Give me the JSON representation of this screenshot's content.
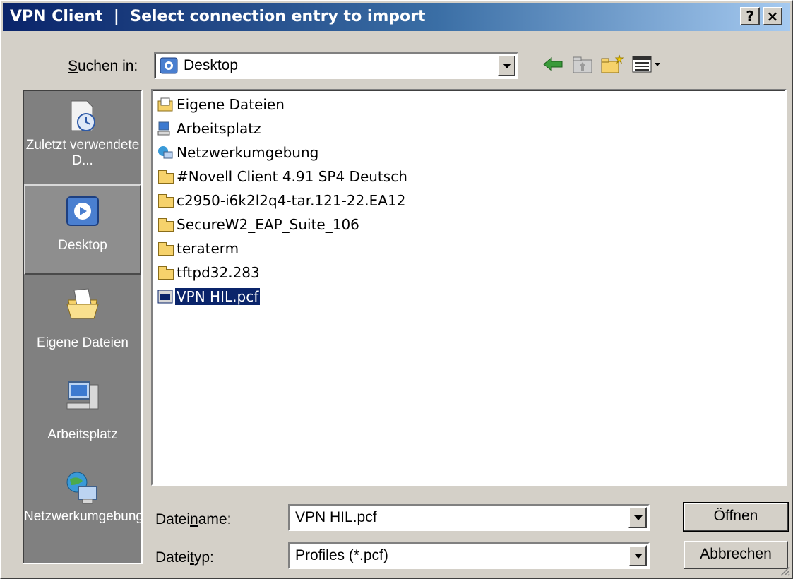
{
  "title": "VPN Client  |  Select connection entry to import",
  "title_buttons": {
    "help": "?",
    "close": "×"
  },
  "toolbar": {
    "look_in_label": "Suchen in:",
    "look_in_value": "Desktop",
    "icons": [
      "back-arrow-icon",
      "up-folder-icon",
      "new-folder-icon",
      "view-menu-icon"
    ]
  },
  "places": [
    {
      "label": "Zuletzt verwendete D...",
      "icon": "recent-documents-icon"
    },
    {
      "label": "Desktop",
      "icon": "desktop-icon",
      "selected": true
    },
    {
      "label": "Eigene Dateien",
      "icon": "my-documents-icon"
    },
    {
      "label": "Arbeitsplatz",
      "icon": "my-computer-icon"
    },
    {
      "label": "Netzwerkumgebung",
      "icon": "network-places-icon"
    }
  ],
  "files": [
    {
      "name": "Eigene Dateien",
      "icon": "my-documents-icon"
    },
    {
      "name": "Arbeitsplatz",
      "icon": "my-computer-icon"
    },
    {
      "name": "Netzwerkumgebung",
      "icon": "network-icon"
    },
    {
      "name": "#Novell Client 4.91 SP4 Deutsch",
      "icon": "folder-icon"
    },
    {
      "name": "c2950-i6k2l2q4-tar.121-22.EA12",
      "icon": "folder-icon"
    },
    {
      "name": "SecureW2_EAP_Suite_106",
      "icon": "folder-icon"
    },
    {
      "name": "teraterm",
      "icon": "folder-icon"
    },
    {
      "name": "tftpd32.283",
      "icon": "folder-icon"
    },
    {
      "name": "VPN HIL.pcf",
      "icon": "pcf-file-icon",
      "selected": true
    }
  ],
  "filename": {
    "label": "Dateiname:",
    "value": "VPN HIL.pcf"
  },
  "filetype": {
    "label": "Dateityp:",
    "value": "Profiles (*.pcf)"
  },
  "buttons": {
    "open": "Öffnen",
    "cancel": "Abbrechen"
  },
  "colors": {
    "title_start": "#0a246a",
    "title_end": "#a6caf0",
    "face": "#d4d0c8",
    "places_bg": "#808080",
    "selection": "#0a246a"
  }
}
